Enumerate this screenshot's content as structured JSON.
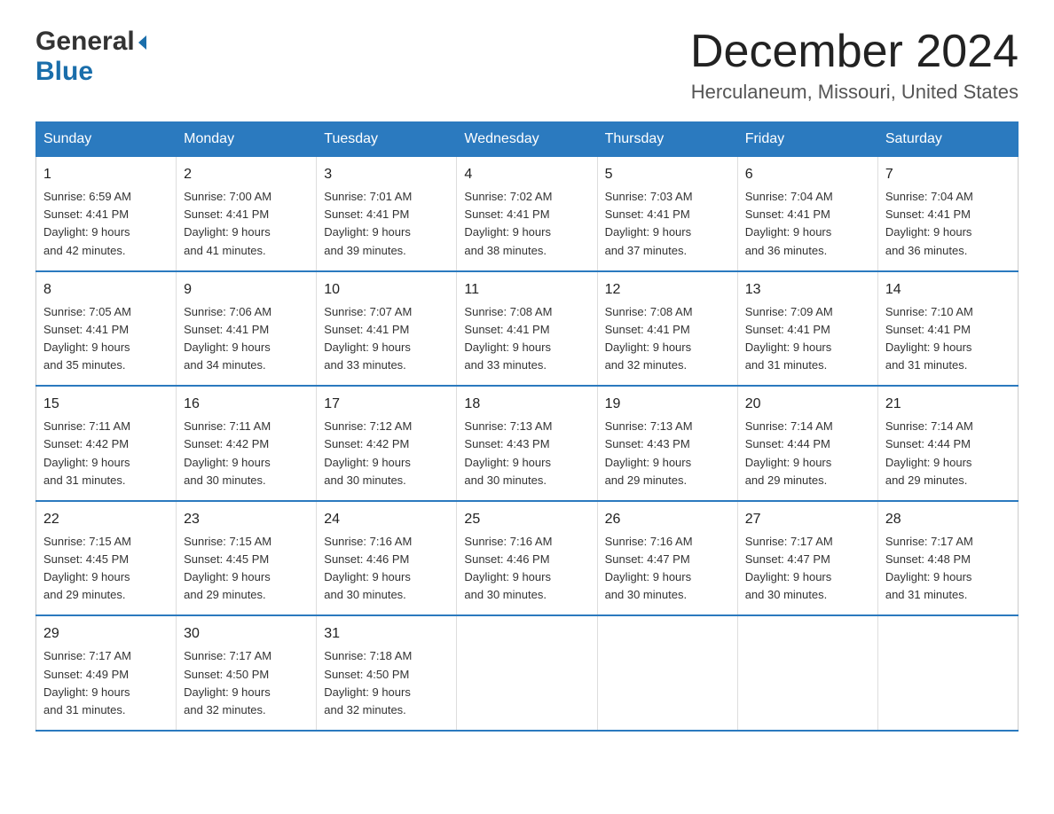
{
  "logo": {
    "text_general": "General",
    "text_blue": "Blue",
    "arrow_symbol": "▶"
  },
  "title": {
    "month": "December 2024",
    "location": "Herculaneum, Missouri, United States"
  },
  "weekdays": [
    "Sunday",
    "Monday",
    "Tuesday",
    "Wednesday",
    "Thursday",
    "Friday",
    "Saturday"
  ],
  "weeks": [
    [
      {
        "day": "1",
        "sunrise": "6:59 AM",
        "sunset": "4:41 PM",
        "daylight": "9 hours and 42 minutes."
      },
      {
        "day": "2",
        "sunrise": "7:00 AM",
        "sunset": "4:41 PM",
        "daylight": "9 hours and 41 minutes."
      },
      {
        "day": "3",
        "sunrise": "7:01 AM",
        "sunset": "4:41 PM",
        "daylight": "9 hours and 39 minutes."
      },
      {
        "day": "4",
        "sunrise": "7:02 AM",
        "sunset": "4:41 PM",
        "daylight": "9 hours and 38 minutes."
      },
      {
        "day": "5",
        "sunrise": "7:03 AM",
        "sunset": "4:41 PM",
        "daylight": "9 hours and 37 minutes."
      },
      {
        "day": "6",
        "sunrise": "7:04 AM",
        "sunset": "4:41 PM",
        "daylight": "9 hours and 36 minutes."
      },
      {
        "day": "7",
        "sunrise": "7:04 AM",
        "sunset": "4:41 PM",
        "daylight": "9 hours and 36 minutes."
      }
    ],
    [
      {
        "day": "8",
        "sunrise": "7:05 AM",
        "sunset": "4:41 PM",
        "daylight": "9 hours and 35 minutes."
      },
      {
        "day": "9",
        "sunrise": "7:06 AM",
        "sunset": "4:41 PM",
        "daylight": "9 hours and 34 minutes."
      },
      {
        "day": "10",
        "sunrise": "7:07 AM",
        "sunset": "4:41 PM",
        "daylight": "9 hours and 33 minutes."
      },
      {
        "day": "11",
        "sunrise": "7:08 AM",
        "sunset": "4:41 PM",
        "daylight": "9 hours and 33 minutes."
      },
      {
        "day": "12",
        "sunrise": "7:08 AM",
        "sunset": "4:41 PM",
        "daylight": "9 hours and 32 minutes."
      },
      {
        "day": "13",
        "sunrise": "7:09 AM",
        "sunset": "4:41 PM",
        "daylight": "9 hours and 31 minutes."
      },
      {
        "day": "14",
        "sunrise": "7:10 AM",
        "sunset": "4:41 PM",
        "daylight": "9 hours and 31 minutes."
      }
    ],
    [
      {
        "day": "15",
        "sunrise": "7:11 AM",
        "sunset": "4:42 PM",
        "daylight": "9 hours and 31 minutes."
      },
      {
        "day": "16",
        "sunrise": "7:11 AM",
        "sunset": "4:42 PM",
        "daylight": "9 hours and 30 minutes."
      },
      {
        "day": "17",
        "sunrise": "7:12 AM",
        "sunset": "4:42 PM",
        "daylight": "9 hours and 30 minutes."
      },
      {
        "day": "18",
        "sunrise": "7:13 AM",
        "sunset": "4:43 PM",
        "daylight": "9 hours and 30 minutes."
      },
      {
        "day": "19",
        "sunrise": "7:13 AM",
        "sunset": "4:43 PM",
        "daylight": "9 hours and 29 minutes."
      },
      {
        "day": "20",
        "sunrise": "7:14 AM",
        "sunset": "4:44 PM",
        "daylight": "9 hours and 29 minutes."
      },
      {
        "day": "21",
        "sunrise": "7:14 AM",
        "sunset": "4:44 PM",
        "daylight": "9 hours and 29 minutes."
      }
    ],
    [
      {
        "day": "22",
        "sunrise": "7:15 AM",
        "sunset": "4:45 PM",
        "daylight": "9 hours and 29 minutes."
      },
      {
        "day": "23",
        "sunrise": "7:15 AM",
        "sunset": "4:45 PM",
        "daylight": "9 hours and 29 minutes."
      },
      {
        "day": "24",
        "sunrise": "7:16 AM",
        "sunset": "4:46 PM",
        "daylight": "9 hours and 30 minutes."
      },
      {
        "day": "25",
        "sunrise": "7:16 AM",
        "sunset": "4:46 PM",
        "daylight": "9 hours and 30 minutes."
      },
      {
        "day": "26",
        "sunrise": "7:16 AM",
        "sunset": "4:47 PM",
        "daylight": "9 hours and 30 minutes."
      },
      {
        "day": "27",
        "sunrise": "7:17 AM",
        "sunset": "4:47 PM",
        "daylight": "9 hours and 30 minutes."
      },
      {
        "day": "28",
        "sunrise": "7:17 AM",
        "sunset": "4:48 PM",
        "daylight": "9 hours and 31 minutes."
      }
    ],
    [
      {
        "day": "29",
        "sunrise": "7:17 AM",
        "sunset": "4:49 PM",
        "daylight": "9 hours and 31 minutes."
      },
      {
        "day": "30",
        "sunrise": "7:17 AM",
        "sunset": "4:50 PM",
        "daylight": "9 hours and 32 minutes."
      },
      {
        "day": "31",
        "sunrise": "7:18 AM",
        "sunset": "4:50 PM",
        "daylight": "9 hours and 32 minutes."
      },
      null,
      null,
      null,
      null
    ]
  ],
  "labels": {
    "sunrise": "Sunrise:",
    "sunset": "Sunset:",
    "daylight": "Daylight:"
  }
}
